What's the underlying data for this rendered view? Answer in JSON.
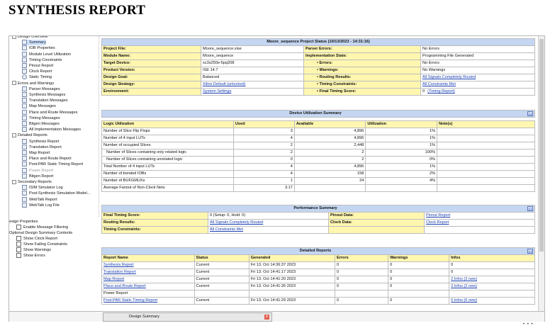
{
  "page_title": "SYNTHESIS REPORT",
  "tree": [
    {
      "label": "Design Overview",
      "indent": 0,
      "kind": "section",
      "cut": true
    },
    {
      "label": "Summary",
      "indent": 2,
      "kind": "doc",
      "selected": true
    },
    {
      "label": "IOB Properties",
      "indent": 2,
      "kind": "doc"
    },
    {
      "label": "Module Level Utilization",
      "indent": 2,
      "kind": "doc"
    },
    {
      "label": "Timing Constraints",
      "indent": 2,
      "kind": "doc"
    },
    {
      "label": "Pinout Report",
      "indent": 2,
      "kind": "doc"
    },
    {
      "label": "Clock Report",
      "indent": 2,
      "kind": "doc"
    },
    {
      "label": "Static Timing",
      "indent": 2,
      "kind": "clock"
    },
    {
      "label": "Errors and Warnings",
      "indent": 0,
      "kind": "section"
    },
    {
      "label": "Parser Messages",
      "indent": 2,
      "kind": "doc"
    },
    {
      "label": "Synthesis Messages",
      "indent": 2,
      "kind": "doc"
    },
    {
      "label": "Translation Messages",
      "indent": 2,
      "kind": "doc"
    },
    {
      "label": "Map Messages",
      "indent": 2,
      "kind": "doc"
    },
    {
      "label": "Place and Route Messages",
      "indent": 2,
      "kind": "doc"
    },
    {
      "label": "Timing Messages",
      "indent": 2,
      "kind": "doc"
    },
    {
      "label": "Bitgen Messages",
      "indent": 2,
      "kind": "doc"
    },
    {
      "label": "All Implementation Messages",
      "indent": 2,
      "kind": "doc"
    },
    {
      "label": "Detailed Reports",
      "indent": 0,
      "kind": "section"
    },
    {
      "label": "Synthesis Report",
      "indent": 2,
      "kind": "doc"
    },
    {
      "label": "Translation Report",
      "indent": 2,
      "kind": "doc"
    },
    {
      "label": "Map Report",
      "indent": 2,
      "kind": "doc"
    },
    {
      "label": "Place and Route Report",
      "indent": 2,
      "kind": "doc"
    },
    {
      "label": "Post-PAR Static Timing Report",
      "indent": 2,
      "kind": "doc"
    },
    {
      "label": "Power Report",
      "indent": 2,
      "kind": "doc",
      "dim": true
    },
    {
      "label": "Bitgen Report",
      "indent": 2,
      "kind": "doc"
    },
    {
      "label": "Secondary Reports",
      "indent": 0,
      "kind": "section"
    },
    {
      "label": "ISIM Simulator Log",
      "indent": 2,
      "kind": "doc"
    },
    {
      "label": "Post-Synthesis Simulation Model...",
      "indent": 2,
      "kind": "doc"
    },
    {
      "label": "WebTalk Report",
      "indent": 2,
      "kind": "doc"
    },
    {
      "label": "WebTalk Log File",
      "indent": 2,
      "kind": "doc"
    }
  ],
  "properties": {
    "design_properties": "esign Properties",
    "enable_filtering": "Enable Message Filtering",
    "optional_contents": "Optional Design Summary Contents",
    "options": [
      "Show Clock Report",
      "Show Failing Constraints",
      "Show Warnings",
      "Show Errors"
    ]
  },
  "status": {
    "header": "Moore_sequence Project Status (10/13/2023 - 14:31:16)",
    "rows": [
      {
        "l1": "Project File:",
        "v1": "Moore_sequence.xise",
        "l2": "Parser Errors:",
        "v2": "No Errors",
        "v2link": false,
        "bullet": false
      },
      {
        "l1": "Module Name:",
        "v1": "Moore_sequence",
        "l2": "Implementation State:",
        "v2": "Programming File Generated",
        "v2link": false,
        "bullet": false
      },
      {
        "l1": "Target Device:",
        "v1": "xc3s250e-5pq208",
        "l2": "Errors:",
        "v2": "No Errors",
        "v2link": false,
        "bullet": true
      },
      {
        "l1": "Product Version:",
        "v1": "ISE 14.7",
        "l2": "Warnings:",
        "v2": "No Warnings",
        "v2link": false,
        "bullet": true
      },
      {
        "l1": "Design Goal:",
        "v1": "Balanced",
        "l2": "Routing Results:",
        "v2": "All Signals Completely Routed",
        "v2link": true,
        "bullet": true
      },
      {
        "l1": "Design Strategy:",
        "v1": "Xilinx Default (unlocked)",
        "v1link": true,
        "l2": "Timing Constraints:",
        "v2": "All Constraints Met",
        "v2link": true,
        "bullet": true
      },
      {
        "l1": "Environment:",
        "v1": "System Settings",
        "v1link": true,
        "l2": "Final Timing Score:",
        "v2": "0",
        "v2extra": "(Timing Report)",
        "v2link": false,
        "bullet": true
      }
    ]
  },
  "utilization": {
    "header": "Device Utilization Summary",
    "columns": [
      "Logic Utilization",
      "Used",
      "Available",
      "Utilization",
      "Note(s)"
    ],
    "rows": [
      {
        "name": "Number of Slice Flip Flops",
        "used": "3",
        "avail": "4,896",
        "util": "1%",
        "sub": false
      },
      {
        "name": "Number of 4 input LUTs",
        "used": "4",
        "avail": "4,896",
        "util": "1%",
        "sub": false
      },
      {
        "name": "Number of occupied Slices",
        "used": "2",
        "avail": "2,448",
        "util": "1%",
        "sub": false
      },
      {
        "name": "Number of Slices containing only related logic",
        "used": "2",
        "avail": "2",
        "util": "100%",
        "sub": true
      },
      {
        "name": "Number of Slices containing unrelated logic",
        "used": "0",
        "avail": "2",
        "util": "0%",
        "sub": true
      },
      {
        "name": "Total Number of 4 input LUTs",
        "used": "4",
        "avail": "4,896",
        "util": "1%",
        "sub": false
      },
      {
        "name": "Number of bonded IOBs",
        "used": "4",
        "avail": "158",
        "util": "2%",
        "sub": false,
        "link": "IOBs"
      },
      {
        "name": "Number of BUFGMUXs",
        "used": "1",
        "avail": "24",
        "util": "4%",
        "sub": false
      },
      {
        "name": "Average Fanout of Non-Clock Nets",
        "used": "3.17",
        "avail": "",
        "util": "",
        "sub": false
      }
    ]
  },
  "performance": {
    "header": "Performance Summary",
    "rows": [
      {
        "l1": "Final Timing Score:",
        "v1": "0 (Setup: 0, Hold: 0)",
        "v1link": false,
        "l2": "Pinout Data:",
        "v2": "Pinout Report"
      },
      {
        "l1": "Routing Results:",
        "v1": "All Signals Completely Routed",
        "v1link": true,
        "l2": "Clock Data:",
        "v2": "Clock Report"
      },
      {
        "l1": "Timing Constraints:",
        "v1": "All Constraints Met",
        "v1link": true,
        "l2": "",
        "v2": ""
      }
    ]
  },
  "detailed": {
    "header": "Detailed Reports",
    "columns": [
      "Report Name",
      "Status",
      "Generated",
      "Errors",
      "Warnings",
      "Infos"
    ],
    "rows": [
      {
        "name": "Synthesis Report",
        "link": true,
        "status": "Current",
        "gen": "Fri 13. Oct 14:36:37 2023",
        "err": "0",
        "warn": "0",
        "info": "0",
        "infolink": false
      },
      {
        "name": "Translation Report",
        "link": true,
        "status": "Current",
        "gen": "Fri 13. Oct 14:41:17 2023",
        "err": "0",
        "warn": "0",
        "info": "0",
        "infolink": false
      },
      {
        "name": "Map Report",
        "link": true,
        "status": "Current",
        "gen": "Fri 13. Oct 14:41:20 2023",
        "err": "0",
        "warn": "0",
        "info": "2 Infos (2 new)",
        "infolink": true
      },
      {
        "name": "Place and Route Report",
        "link": true,
        "status": "Current",
        "gen": "Fri 13. Oct 14:41:26 2023",
        "err": "0",
        "warn": "0",
        "info": "2 Infos (2 new)",
        "infolink": true
      },
      {
        "name": "Power Report",
        "link": false,
        "status": "",
        "gen": "",
        "err": "",
        "warn": "",
        "info": "",
        "infolink": false
      },
      {
        "name": "Post-PAR Static Timing Report",
        "link": true,
        "status": "Current",
        "gen": "Fri 13. Oct 14:41:29 2023",
        "err": "0",
        "warn": "0",
        "info": "6 Infos (6 new)",
        "infolink": true
      }
    ]
  },
  "bottom_tab": {
    "label": "Design Summary",
    "close": "x"
  },
  "collapse_glyph": "[-]",
  "corner_dots": "• • •"
}
